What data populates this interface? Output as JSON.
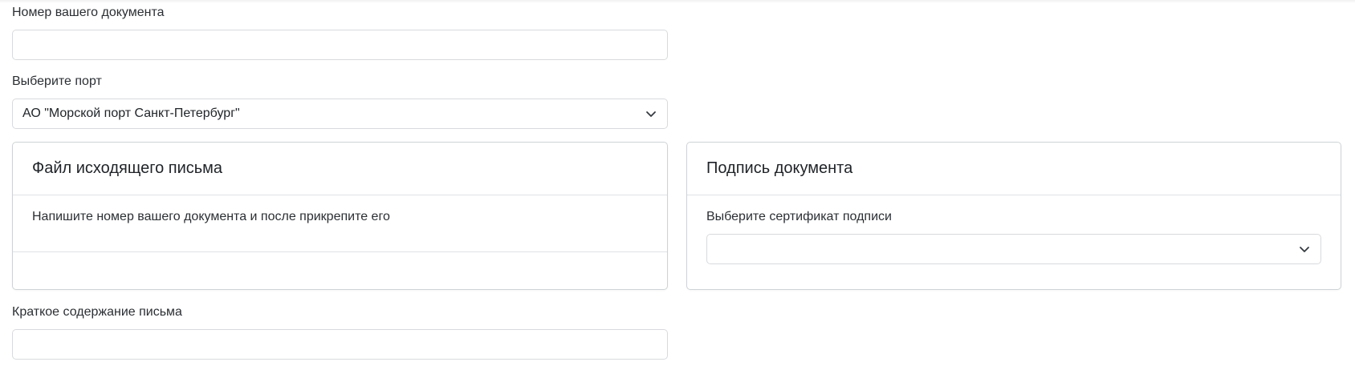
{
  "form": {
    "document_number": {
      "label": "Номер вашего документа",
      "value": ""
    },
    "port": {
      "label": "Выберите порт",
      "selected": "АО \"Морской порт Санкт-Петербург\""
    },
    "summary": {
      "label": "Краткое содержание письма",
      "value": ""
    }
  },
  "outgoing_file_card": {
    "title": "Файл исходящего письма",
    "hint": "Напишите номер вашего документа и после прикрепите его"
  },
  "signature_card": {
    "title": "Подпись документа",
    "certificate_label": "Выберите сертификат подписи",
    "certificate_selected": ""
  },
  "icons": {
    "port_select": "chevron-down-icon",
    "certificate_select": "chevron-down-icon"
  }
}
